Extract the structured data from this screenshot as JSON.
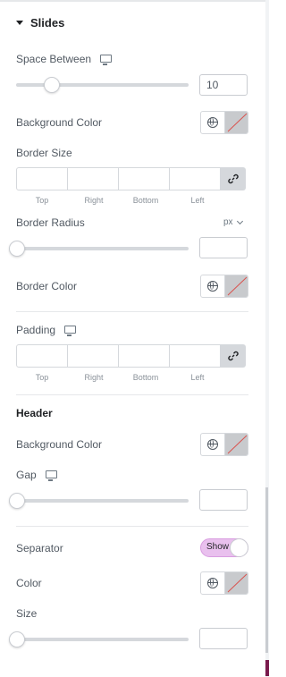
{
  "section": {
    "title": "Slides"
  },
  "space_between": {
    "label": "Space Between",
    "value": "10",
    "slider": 0.2
  },
  "background_color": {
    "label": "Background Color"
  },
  "border_size": {
    "label": "Border Size",
    "dims": [
      "Top",
      "Right",
      "Bottom",
      "Left"
    ]
  },
  "border_radius": {
    "label": "Border Radius",
    "unit": "px",
    "value": "",
    "slider": 0
  },
  "border_color": {
    "label": "Border Color"
  },
  "padding": {
    "label": "Padding",
    "dims": [
      "Top",
      "Right",
      "Bottom",
      "Left"
    ]
  },
  "header": {
    "title": "Header",
    "background_label": "Background Color",
    "gap_label": "Gap",
    "gap_value": "",
    "gap_slider": 0
  },
  "separator": {
    "label": "Separator",
    "toggle_label": "Show",
    "color_label": "Color",
    "size_label": "Size",
    "size_value": "",
    "size_slider": 0
  },
  "colors": {
    "accent_toggle": "#e9c0ee",
    "swatch_strike": "#d9534f",
    "scroll_mark": "#7a1b4d"
  },
  "icons": {
    "collapse": "caret-down-icon",
    "responsive": "monitor-icon",
    "global": "globe-icon",
    "link": "link-icon",
    "no_color": "no-color-swatch"
  }
}
